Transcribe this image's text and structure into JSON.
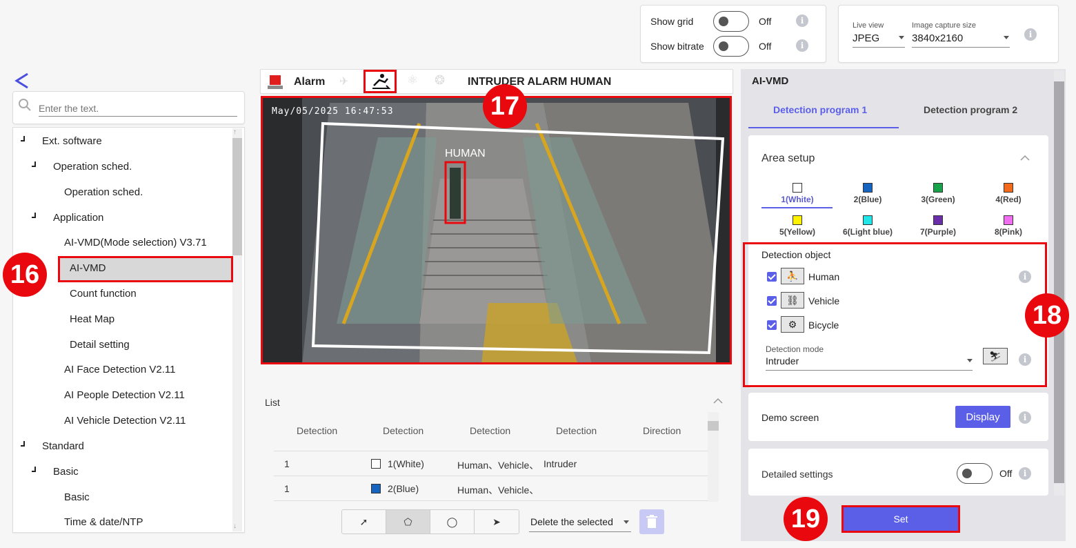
{
  "topbar": {
    "show_grid_label": "Show grid",
    "show_grid_state": "Off",
    "show_bitrate_label": "Show bitrate",
    "show_bitrate_state": "Off",
    "live_view_label": "Live view",
    "live_view_value": "JPEG",
    "capture_size_label": "Image capture size",
    "capture_size_value": "3840x2160"
  },
  "sidebar": {
    "search_placeholder": "Enter the text.",
    "items": [
      {
        "label": "Ext. software"
      },
      {
        "label": "Operation sched."
      },
      {
        "label": "Operation sched."
      },
      {
        "label": "Application"
      },
      {
        "label": "AI-VMD(Mode selection) V3.71"
      },
      {
        "label": "AI-VMD"
      },
      {
        "label": "Count function"
      },
      {
        "label": "Heat Map"
      },
      {
        "label": "Detail setting"
      },
      {
        "label": "AI Face Detection V2.11"
      },
      {
        "label": "AI People Detection V2.11"
      },
      {
        "label": "AI Vehicle Detection V2.11"
      },
      {
        "label": "Standard"
      },
      {
        "label": "Basic"
      },
      {
        "label": "Basic"
      },
      {
        "label": "Time & date/NTP"
      }
    ]
  },
  "alarm_bar": {
    "alarm_label": "Alarm",
    "alarm_text": "INTRUDER ALARM HUMAN"
  },
  "video": {
    "timestamp": "May/05/2025 16:47:53",
    "detection_label": "HUMAN"
  },
  "list": {
    "title": "List",
    "headers": [
      "Detection",
      "Detection",
      "Detection",
      "Detection",
      "Direction"
    ],
    "rows": [
      {
        "c1": "1",
        "area": "1(White)",
        "objects": "Human、Vehicle、",
        "mode": "Intruder",
        "color": "#ffffff"
      },
      {
        "c1": "1",
        "area": "2(Blue)",
        "objects": "Human、Vehicle、",
        "mode": "",
        "color": "#1565c0"
      }
    ],
    "delete_label": "Delete the selected"
  },
  "panel": {
    "title": "AI-VMD",
    "tabs": [
      "Detection program 1",
      "Detection program 2"
    ],
    "area_setup_title": "Area setup",
    "areas": [
      {
        "label": "1(White)",
        "color": "#ffffff"
      },
      {
        "label": "2(Blue)",
        "color": "#1565c0"
      },
      {
        "label": "3(Green)",
        "color": "#18a34a"
      },
      {
        "label": "4(Red)",
        "color": "#f26a1b"
      },
      {
        "label": "5(Yellow)",
        "color": "#fff200"
      },
      {
        "label": "6(Light blue)",
        "color": "#22e5e8"
      },
      {
        "label": "7(Purple)",
        "color": "#6a2fa8"
      },
      {
        "label": "8(Pink)",
        "color": "#f06ef0"
      }
    ],
    "detection_object_title": "Detection object",
    "objects": [
      "Human",
      "Vehicle",
      "Bicycle"
    ],
    "detection_mode_label": "Detection mode",
    "detection_mode_value": "Intruder",
    "demo_screen_label": "Demo screen",
    "display_button": "Display",
    "detailed_settings_label": "Detailed settings",
    "detailed_settings_state": "Off",
    "set_button": "Set"
  },
  "callouts": [
    "16",
    "17",
    "18",
    "19"
  ],
  "colors": {
    "accent": "#5b5fe8",
    "callout_red": "#e8080d"
  }
}
